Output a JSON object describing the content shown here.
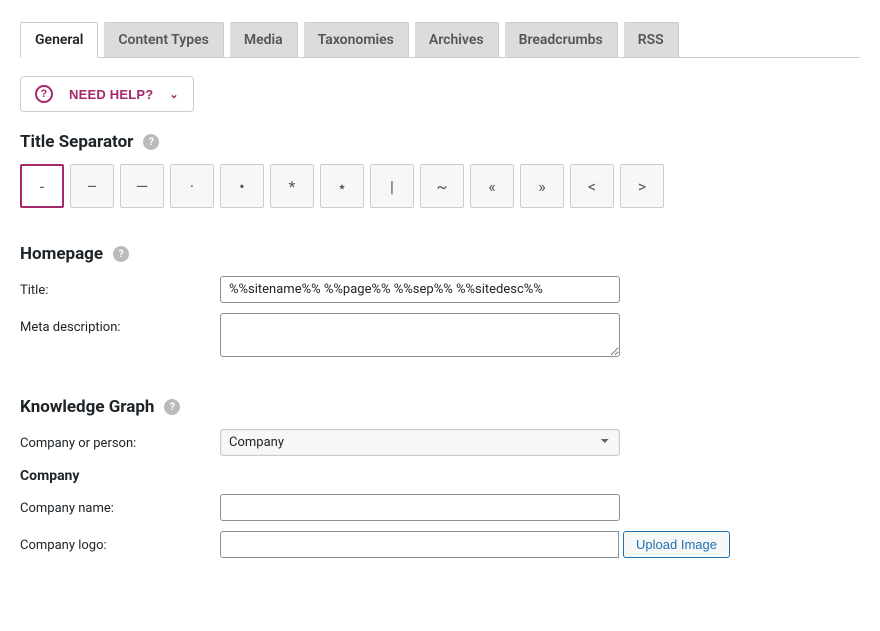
{
  "tabs": [
    "General",
    "Content Types",
    "Media",
    "Taxonomies",
    "Archives",
    "Breadcrumbs",
    "RSS"
  ],
  "active_tab": "General",
  "help_button": {
    "label": "NEED HELP?"
  },
  "title_separator": {
    "heading": "Title Separator",
    "options": [
      "-",
      "–",
      "—",
      "·",
      "•",
      "*",
      "⋆",
      "|",
      "~",
      "«",
      "»",
      "<",
      ">"
    ],
    "selected": "-"
  },
  "homepage": {
    "heading": "Homepage",
    "title_label": "Title:",
    "title_value": "%%sitename%% %%page%% %%sep%% %%sitedesc%%",
    "meta_label": "Meta description:",
    "meta_value": ""
  },
  "knowledge_graph": {
    "heading": "Knowledge Graph",
    "company_or_person_label": "Company or person:",
    "company_or_person_value": "Company",
    "company_subheading": "Company",
    "company_name_label": "Company name:",
    "company_name_value": "",
    "company_logo_label": "Company logo:",
    "company_logo_value": "",
    "upload_button": "Upload Image"
  }
}
